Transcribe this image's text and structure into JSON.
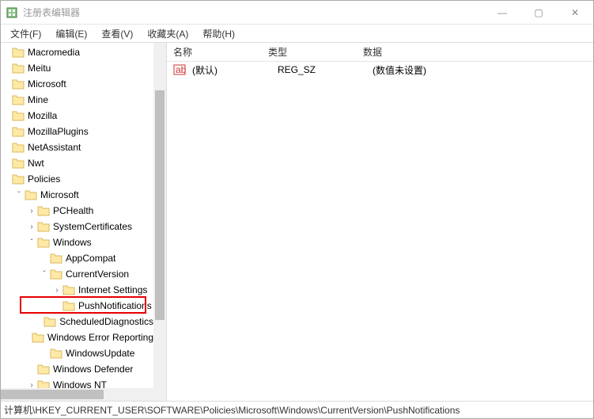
{
  "title": "注册表编辑器",
  "window_controls": {
    "min": "—",
    "max": "▢",
    "close": "✕"
  },
  "menu": [
    "文件(F)",
    "编辑(E)",
    "查看(V)",
    "收藏夹(A)",
    "帮助(H)"
  ],
  "tree": [
    {
      "indent": 0,
      "twisty": "",
      "label": "Macromedia"
    },
    {
      "indent": 0,
      "twisty": "",
      "label": "Meitu"
    },
    {
      "indent": 0,
      "twisty": "",
      "label": "Microsoft"
    },
    {
      "indent": 0,
      "twisty": "",
      "label": "Mine"
    },
    {
      "indent": 0,
      "twisty": "",
      "label": "Mozilla"
    },
    {
      "indent": 0,
      "twisty": "",
      "label": "MozillaPlugins"
    },
    {
      "indent": 0,
      "twisty": "",
      "label": "NetAssistant"
    },
    {
      "indent": 0,
      "twisty": "",
      "label": "Nwt"
    },
    {
      "indent": 0,
      "twisty": "",
      "label": "Policies"
    },
    {
      "indent": 1,
      "twisty": "v",
      "label": "Microsoft"
    },
    {
      "indent": 2,
      "twisty": ">",
      "label": "PCHealth"
    },
    {
      "indent": 2,
      "twisty": ">",
      "label": "SystemCertificates"
    },
    {
      "indent": 2,
      "twisty": "v",
      "label": "Windows"
    },
    {
      "indent": 3,
      "twisty": "",
      "label": "AppCompat"
    },
    {
      "indent": 3,
      "twisty": "v",
      "label": "CurrentVersion"
    },
    {
      "indent": 4,
      "twisty": ">",
      "label": "Internet Settings"
    },
    {
      "indent": 4,
      "twisty": "",
      "label": "PushNotifications",
      "highlighted": true
    },
    {
      "indent": 3,
      "twisty": "",
      "label": "ScheduledDiagnostics"
    },
    {
      "indent": 3,
      "twisty": "",
      "label": "Windows Error Reporting"
    },
    {
      "indent": 3,
      "twisty": "",
      "label": "WindowsUpdate"
    },
    {
      "indent": 2,
      "twisty": "",
      "label": "Windows Defender"
    },
    {
      "indent": 2,
      "twisty": ">",
      "label": "Windows NT"
    }
  ],
  "columns": {
    "name": "名称",
    "type": "类型",
    "data": "数据"
  },
  "rows": [
    {
      "name": "(默认)",
      "type": "REG_SZ",
      "data": "(数值未设置)"
    }
  ],
  "status": "计算机\\HKEY_CURRENT_USER\\SOFTWARE\\Policies\\Microsoft\\Windows\\CurrentVersion\\PushNotifications",
  "colors": {
    "highlight": "#e60000",
    "folder_fill": "#ffe9a6",
    "folder_stroke": "#d9b95c"
  }
}
